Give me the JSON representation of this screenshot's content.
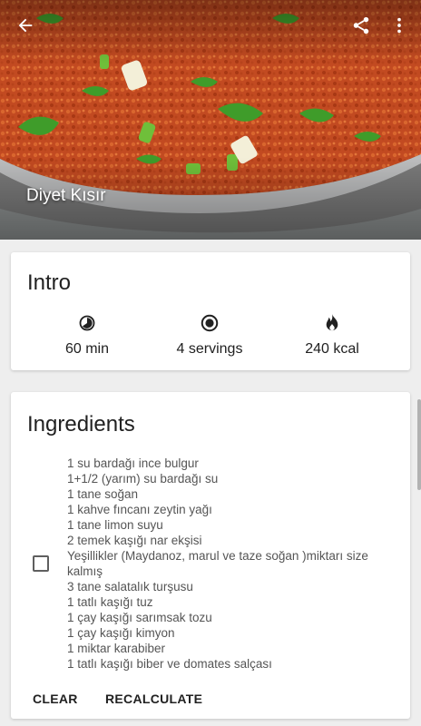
{
  "header": {
    "title": "Diyet Kısır",
    "back_icon": "arrow-left-icon",
    "share_icon": "share-icon",
    "more_icon": "more-vert-icon"
  },
  "intro": {
    "title": "Intro",
    "stats": [
      {
        "icon": "timer-icon",
        "label": "60 min"
      },
      {
        "icon": "servings-icon",
        "label": "4 servings"
      },
      {
        "icon": "flame-icon",
        "label": "240 kcal"
      }
    ]
  },
  "ingredients": {
    "title": "Ingredients",
    "items": [
      "1 su bardağı ince bulgur",
      "1+1/2 (yarım) su bardağı su",
      "1 tane soğan",
      "1 kahve fıncanı zeytin yağı",
      "1 tane limon suyu",
      "2 temek kaşığı nar ekşisi",
      "Yeşillikler (Maydanoz, marul ve taze soğan )miktarı size kalmış",
      "3 tane salatalık turşusu",
      "1 tatlı kaşığı tuz",
      "1 çay kaşığı sarımsak tozu",
      "1 çay kaşığı kimyon",
      "1 miktar karabiber",
      "1 tatlı kaşığı biber ve domates salçası"
    ],
    "clear_label": "CLEAR",
    "recalculate_label": "RECALCULATE"
  },
  "colors": {
    "background": "#eeeeee",
    "card": "#ffffff",
    "text": "#212121"
  }
}
